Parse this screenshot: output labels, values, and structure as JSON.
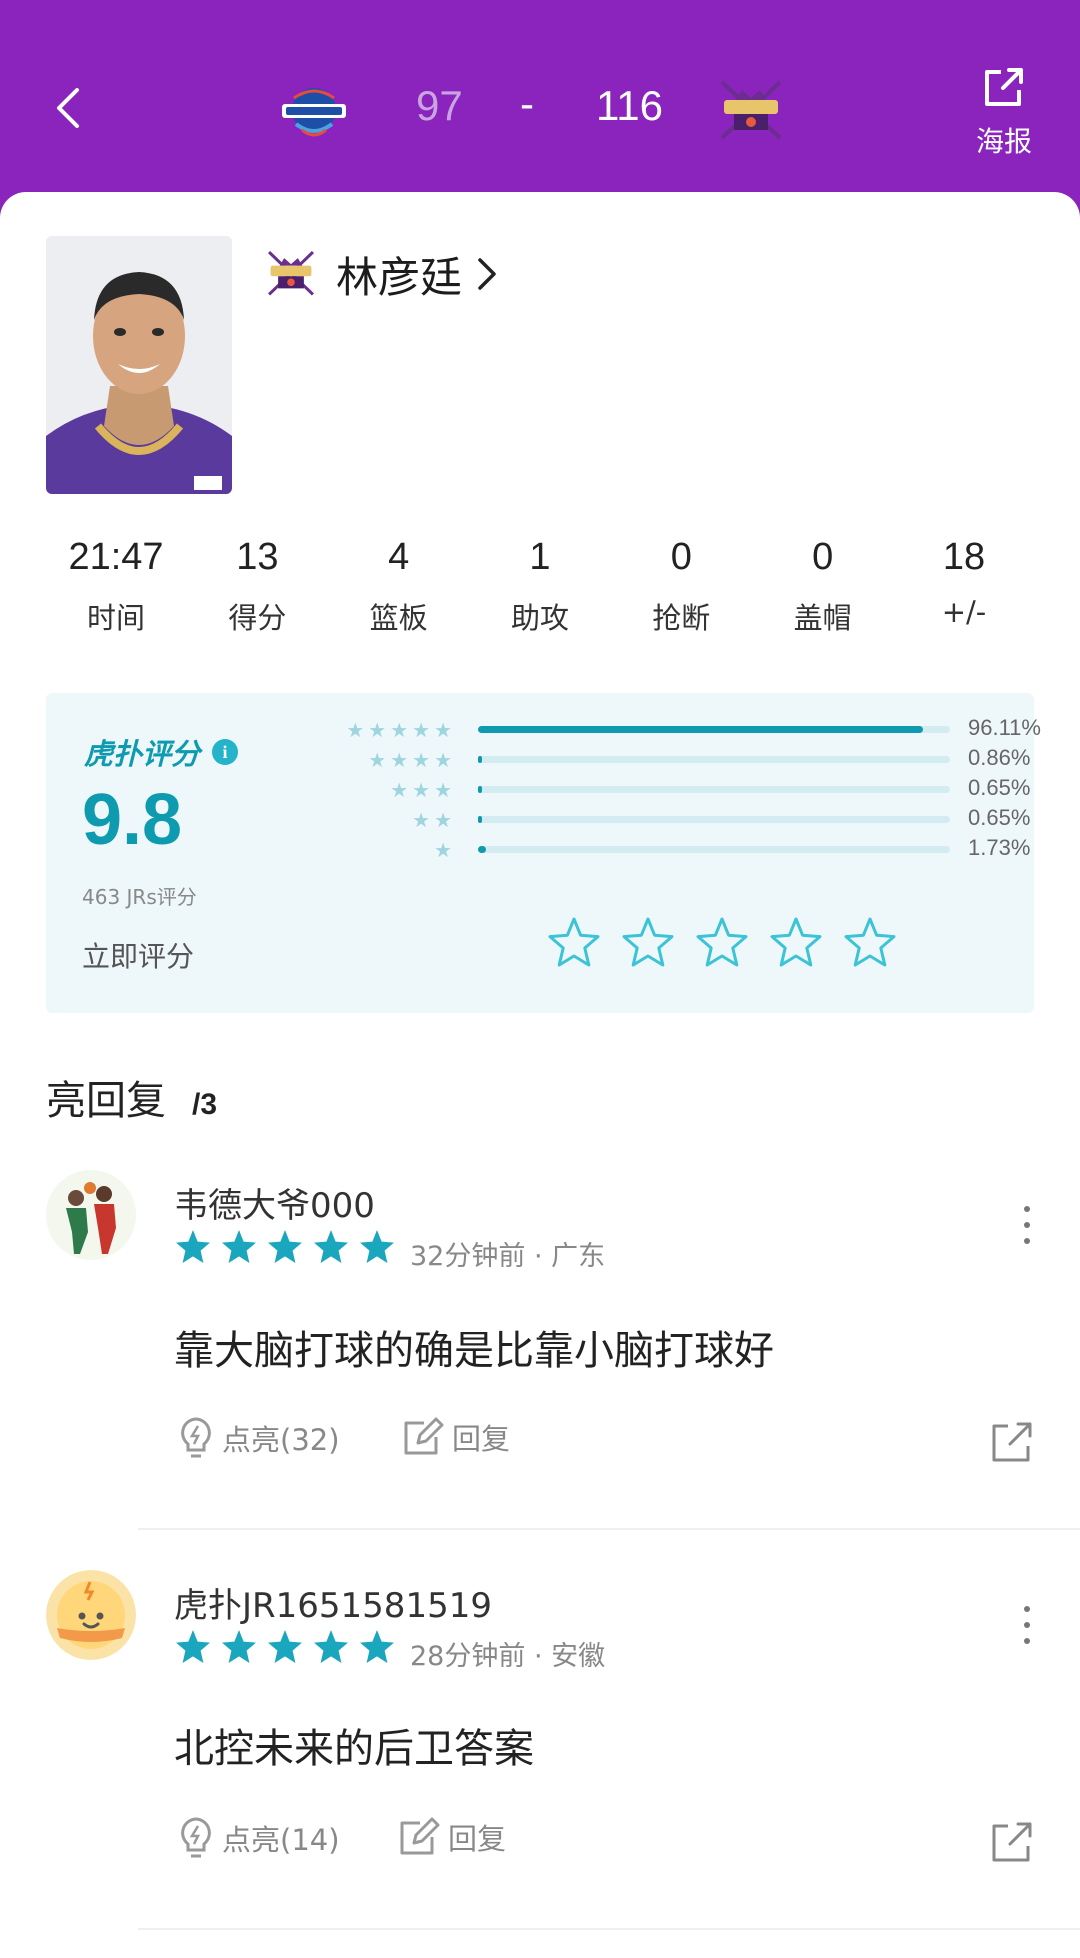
{
  "header": {
    "home_score": "97",
    "dash": "-",
    "away_score": "116",
    "poster_label": "海报"
  },
  "player": {
    "name": "林彦廷"
  },
  "stats": [
    {
      "value": "21:47",
      "label": "时间"
    },
    {
      "value": "13",
      "label": "得分"
    },
    {
      "value": "4",
      "label": "篮板"
    },
    {
      "value": "1",
      "label": "助攻"
    },
    {
      "value": "0",
      "label": "抢断"
    },
    {
      "value": "0",
      "label": "盖帽"
    },
    {
      "value": "18",
      "label": "+/-"
    }
  ],
  "rating": {
    "brand": "虎扑评分",
    "score": "9.8",
    "count_label": "463 JRs评分",
    "rate_now": "立即评分",
    "distribution": [
      {
        "stars": 5,
        "percent": "96.11%",
        "fraction": 0.9611
      },
      {
        "stars": 4,
        "percent": "0.86%",
        "fraction": 0.0086
      },
      {
        "stars": 3,
        "percent": "0.65%",
        "fraction": 0.0065
      },
      {
        "stars": 2,
        "percent": "0.65%",
        "fraction": 0.0065
      },
      {
        "stars": 1,
        "percent": "1.73%",
        "fraction": 0.0173
      }
    ]
  },
  "replies": {
    "title": "亮回复",
    "count": "/3",
    "items": [
      {
        "user": "韦德大爷000",
        "stars": 5,
        "meta": "32分钟前 · 广东",
        "text": "靠大脑打球的确是比靠小脑打球好",
        "like_label": "点亮(32)",
        "reply_label": "回复"
      },
      {
        "user": "虎扑JR1651581519",
        "stars": 5,
        "meta": "28分钟前 · 安徽",
        "text": "北控未来的后卫答案",
        "like_label": "点亮(14)",
        "reply_label": "回复"
      }
    ]
  },
  "colors": {
    "header_bg": "#8a24bd",
    "accent": "#0e9bb0",
    "rating_bg": "#eef8fb"
  }
}
